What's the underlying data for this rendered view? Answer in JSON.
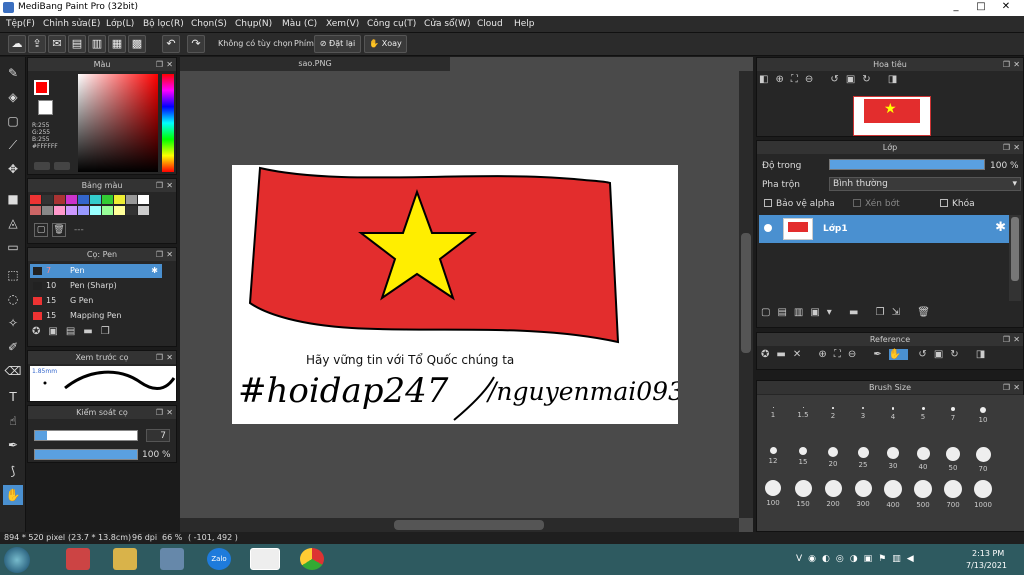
{
  "window": {
    "title": "MediBang Paint Pro (32bit)",
    "min": "_",
    "max": "□",
    "close": "✕"
  },
  "menu": [
    "Tệp(F)",
    "Chỉnh sửa(E)",
    "Lớp(L)",
    "Bộ lọc(R)",
    "Chọn(S)",
    "Chụp(N)",
    "Màu (C)",
    "Xem(V)",
    "Công cụ(T)",
    "Cửa sổ(W)",
    "Cloud",
    "Help"
  ],
  "toolbar": {
    "no_option": "Không có tùy chọn",
    "shortcut": "Phím",
    "reset": "Đặt lại",
    "rotate": "Xoay"
  },
  "color_panel": {
    "title": "Màu",
    "r": "R:255",
    "g": "G:255",
    "b": "B:255",
    "hex": "#FFFFFF"
  },
  "palette_panel": {
    "title": "Bảng màu",
    "dash": "---"
  },
  "brush_panel": {
    "title": "Cọ: Pen",
    "items": [
      {
        "size": "7",
        "name": "Pen"
      },
      {
        "size": "10",
        "name": "Pen (Sharp)"
      },
      {
        "size": "15",
        "name": "G Pen"
      },
      {
        "size": "15",
        "name": "Mapping Pen"
      }
    ]
  },
  "preview_panel": {
    "title": "Xem trước cọ",
    "size": "1.85mm"
  },
  "control_panel": {
    "title": "Kiểm soát cọ",
    "size": "7",
    "opacity": "100 %"
  },
  "document": {
    "tab": "sao.PNG",
    "caption": "Hãy vững tin với Tổ Quốc chúng ta",
    "hashtag": "#hoidap247",
    "user": "/nguyenmai093"
  },
  "navigator": {
    "title": "Hoa tiêu"
  },
  "layer_panel": {
    "title": "Lớp",
    "opacity_label": "Độ trong",
    "opacity_value": "100 %",
    "blend_label": "Pha trộn",
    "blend_value": "Bình thường",
    "protect_alpha": "Bảo vệ alpha",
    "clipping": "Xén bớt",
    "lock": "Khóa",
    "layer_name": "Lớp1"
  },
  "reference_panel": {
    "title": "Reference"
  },
  "brushsize_panel": {
    "title": "Brush Size",
    "sizes": [
      "1",
      "1.5",
      "2",
      "3",
      "4",
      "5",
      "7",
      "10",
      "12",
      "15",
      "20",
      "25",
      "30",
      "40",
      "50",
      "70",
      "100",
      "150",
      "200",
      "300",
      "400",
      "500",
      "700",
      "1000"
    ]
  },
  "status": {
    "dims": "894 * 520 pixel",
    "cm": "(23.7 * 13.8cm)",
    "dpi": "96 dpi",
    "zoom": "66 %",
    "coord": "( -101, 492 )"
  },
  "taskbar": {
    "time": "2:13 PM",
    "date": "7/13/2021",
    "zalo": "Zalo"
  },
  "colors": {
    "flag_red": "#e32d2d",
    "star": "#ffee00",
    "accent": "#4a90d0"
  }
}
